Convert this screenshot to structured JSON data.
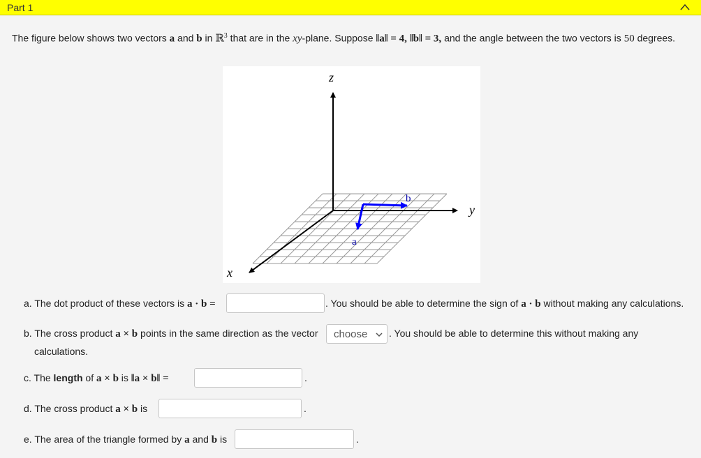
{
  "part": {
    "title": "Part 1"
  },
  "intro": {
    "t1": "The figure below shows two vectors ",
    "a": "a",
    "t2": " and ",
    "b": "b",
    "t3": " in ",
    "R": "ℝ",
    "R_exp": "3",
    "t4": " that are in the ",
    "plane": "xy",
    "t5": "-plane. Suppose ",
    "norm_a": "‖a‖ = 4,",
    "t6": " ",
    "norm_b": "‖b‖ = 3,",
    "t7": " and the angle between the two vectors is ",
    "angle": "50",
    "t8": " degrees."
  },
  "figure": {
    "z_label": "z",
    "y_label": "y",
    "x_label": "x",
    "a_label": "a",
    "b_label": "b",
    "colors": {
      "axis": "#000000",
      "grid": "#9a9a9a",
      "vector": "#0000ff",
      "label": "#0000aa"
    }
  },
  "questions": {
    "a": {
      "prefix": "a. The dot product of these vectors is ",
      "expr": "a · b =",
      "suffix_pre": ". You should be able to determine the sign of ",
      "expr2": "a · b",
      "suffix_post": " without making any calculations.",
      "answer": ""
    },
    "b": {
      "prefix": "b. The cross product ",
      "expr": "a × b",
      "mid": " points in the same direction as the vector",
      "select_value": "choose",
      "suffix": ". You should be able to determine this without making any",
      "suffix2": "calculations."
    },
    "c": {
      "prefix": "c. The ",
      "bold": "length",
      "mid": " of ",
      "expr": "a × b",
      "is": " is ",
      "expr2": "‖a × b‖ =",
      "period": ".",
      "answer": ""
    },
    "d": {
      "prefix": "d. The cross product ",
      "expr": "a × b",
      "is": " is",
      "period": ".",
      "answer": ""
    },
    "e": {
      "prefix": "e. The area of the triangle formed by ",
      "a": "a",
      "and": " and ",
      "b": "b",
      "is": " is",
      "period": ".",
      "answer": ""
    }
  }
}
